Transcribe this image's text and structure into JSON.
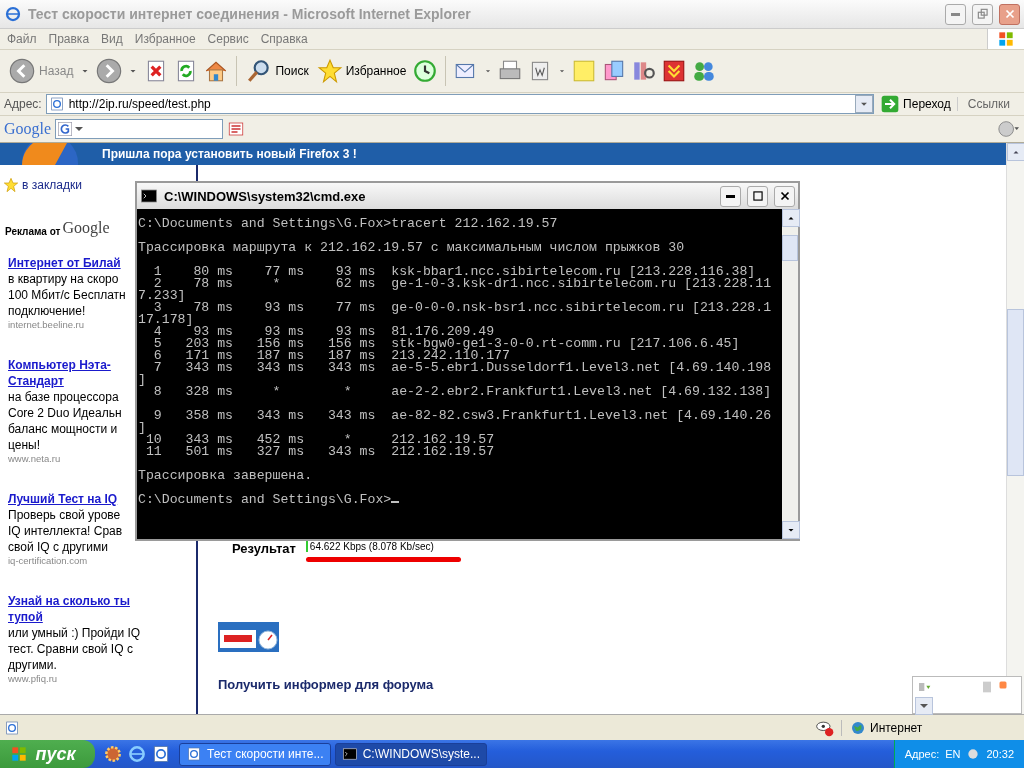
{
  "window": {
    "title": "Тест скорости интернет соединения - Microsoft Internet Explorer"
  },
  "menu": [
    "Файл",
    "Правка",
    "Вид",
    "Избранное",
    "Сервис",
    "Справка"
  ],
  "toolbar": {
    "back_label": "Назад",
    "search_label": "Поиск",
    "favorites_label": "Избранное"
  },
  "address": {
    "label": "Адрес:",
    "value": "http://2ip.ru/speed/test.php",
    "go_label": "Переход",
    "links_label": "Ссылки"
  },
  "google_bar": {
    "logo": "Google"
  },
  "page": {
    "banner": "Пришла пора установить новый Firefox 3 !",
    "bookmark": "в закладки",
    "ads_label": "Реклама от",
    "ads_logo": "Google",
    "ads": [
      {
        "title_lines": [
          "Интернет от Билай"
        ],
        "lines": [
          "в квартиру на скоро",
          "100 Мбит/с Бесплатн",
          "подключение!"
        ],
        "url": "internet.beeline.ru"
      },
      {
        "title_lines": [
          "Компьютер Нэта-",
          "Стандарт"
        ],
        "lines": [
          "на базе процессора",
          "Core 2 Duo Идеальн",
          "баланс мощности и",
          "цены!"
        ],
        "url": "www.neta.ru"
      },
      {
        "title_lines": [
          "Лучший Тест на IQ"
        ],
        "lines": [
          "Проверь свой урове",
          "IQ интеллекта! Срав",
          "свой IQ с другими"
        ],
        "url": "iq-certification.com"
      },
      {
        "title_lines": [
          "Узнай на сколько ты",
          "тупой"
        ],
        "lines": [
          "или умный :) Пройди IQ",
          "тест. Сравни свой IQ с",
          "другими."
        ],
        "url": "www.pfiq.ru"
      }
    ],
    "result_label": "Результат",
    "result_value": "64.622 Kbps (8.078 Kb/sec)",
    "informer_link": "Получить информер для форума"
  },
  "console": {
    "title": "C:\\WINDOWS\\system32\\cmd.exe",
    "blocks": [
      [
        "C:\\Documents and Settings\\G.Fox>tracert 212.162.19.57"
      ],
      [
        "Трассировка маршрута к 212.162.19.57 с максимальным числом прыжков 30"
      ],
      [
        "  1    80 ms    77 ms    93 ms  ksk-bbar1.ncc.sibirtelecom.ru [213.228.116.38]",
        "  2    78 ms     *       62 ms  ge-1-0-3.ksk-dr1.ncc.sibirtelecom.ru [213.228.11",
        "7.233]",
        "  3    78 ms    93 ms    77 ms  ge-0-0-0.nsk-bsr1.ncc.sibirtelecom.ru [213.228.1",
        "17.178]",
        "  4    93 ms    93 ms    93 ms  81.176.209.49",
        "  5   203 ms   156 ms   156 ms  stk-bgw0-ge1-3-0-0.rt-comm.ru [217.106.6.45]",
        "  6   171 ms   187 ms   187 ms  213.242.110.177",
        "  7   343 ms   343 ms   343 ms  ae-5-5.ebr1.Dusseldorf1.Level3.net [4.69.140.198",
        "]",
        "  8   328 ms     *        *     ae-2-2.ebr2.Frankfurt1.Level3.net [4.69.132.138]"
      ],
      [
        "  9   358 ms   343 ms   343 ms  ae-82-82.csw3.Frankfurt1.Level3.net [4.69.140.26",
        "]",
        " 10   343 ms   452 ms     *     212.162.19.57",
        " 11   501 ms   327 ms   343 ms  212.162.19.57"
      ],
      [
        "Трассировка завершена."
      ],
      [
        "C:\\Documents and Settings\\G.Fox>"
      ]
    ]
  },
  "status_bar": {
    "zone": "Интернет"
  },
  "taskbar": {
    "start": "пуск",
    "tasks": [
      {
        "label": "Тест скорости инте...",
        "selected": false
      },
      {
        "label": "C:\\WINDOWS\\syste...",
        "selected": true
      }
    ],
    "tray": {
      "address": "Адрес:",
      "lang": "EN",
      "time": "20:32"
    }
  }
}
